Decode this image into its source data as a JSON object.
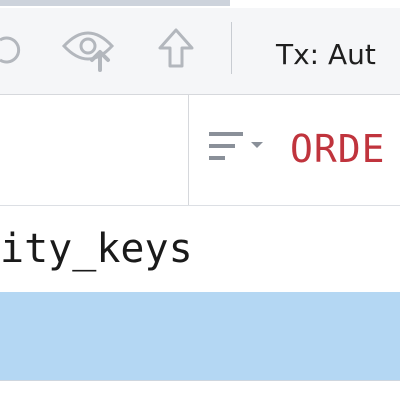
{
  "toolbar": {
    "buttons": [
      {
        "icon": "refresh-partial-icon"
      },
      {
        "icon": "eye-upload-icon"
      },
      {
        "icon": "arrow-up-icon"
      }
    ],
    "transaction_label": "Tx: Aut"
  },
  "editor": {
    "sort_icon": "sort-lines-icon",
    "keyword_text": "ORDE"
  },
  "result": {
    "row_text": "ity_keys",
    "selected_row_color": "#b4d7f3"
  },
  "colors": {
    "keyword": "#c0343d",
    "toolbar_bg": "#f5f6f8",
    "selection": "#b4d7f3"
  }
}
